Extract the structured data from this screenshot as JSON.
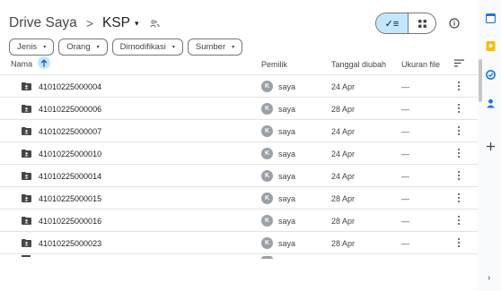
{
  "breadcrumb": {
    "root": "Drive Saya",
    "separator": ">",
    "current": "KSP",
    "caret": "▾"
  },
  "view_toggle": {
    "list_icon": "check-list-icon",
    "list_glyph": "✓≡",
    "grid_icon": "grid-icon"
  },
  "filters": [
    {
      "label": "Jenis",
      "caret": "▾"
    },
    {
      "label": "Orang",
      "caret": "▾"
    },
    {
      "label": "Dimodifikasi",
      "caret": "▾"
    },
    {
      "label": "Sumber",
      "caret": "▾"
    }
  ],
  "columns": {
    "name": "Nama",
    "owner": "Pemilik",
    "modified": "Tanggal diubah",
    "size": "Ukuran file"
  },
  "rows": [
    {
      "name": "41010225000004",
      "owner": "saya",
      "avatar": "K",
      "date": "24 Apr",
      "size": "—"
    },
    {
      "name": "41010225000006",
      "owner": "saya",
      "avatar": "K",
      "date": "28 Apr",
      "size": "—"
    },
    {
      "name": "41010225000007",
      "owner": "saya",
      "avatar": "K",
      "date": "24 Apr",
      "size": "—"
    },
    {
      "name": "41010225000010",
      "owner": "saya",
      "avatar": "K",
      "date": "24 Apr",
      "size": "—"
    },
    {
      "name": "41010225000014",
      "owner": "saya",
      "avatar": "K",
      "date": "24 Apr",
      "size": "—"
    },
    {
      "name": "41010225000015",
      "owner": "saya",
      "avatar": "K",
      "date": "28 Apr",
      "size": "—"
    },
    {
      "name": "41010225000016",
      "owner": "saya",
      "avatar": "K",
      "date": "28 Apr",
      "size": "—"
    },
    {
      "name": "41010225000023",
      "owner": "saya",
      "avatar": "K",
      "date": "28 Apr",
      "size": "—"
    }
  ],
  "side_rail": [
    {
      "icon": "calendar-icon",
      "color": "#1a73e8"
    },
    {
      "icon": "keep-icon",
      "color": "#fbbc04"
    },
    {
      "icon": "tasks-icon",
      "color": "#1a73e8"
    },
    {
      "icon": "contacts-icon",
      "color": "#1a73e8"
    },
    {
      "icon": "add-icon",
      "color": "#444746"
    }
  ],
  "colors": {
    "accent": "#c2e7ff",
    "accent_dark": "#0b57d0",
    "text": "#1f1f1f",
    "muted": "#444746",
    "divider": "#e1e3e1"
  }
}
